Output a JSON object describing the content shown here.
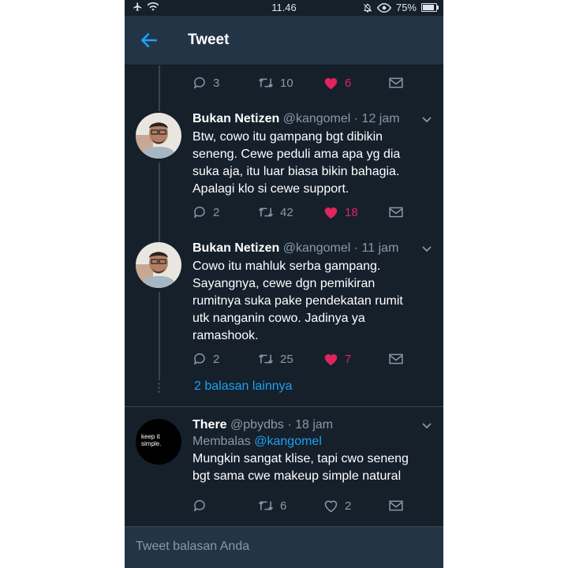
{
  "statusbar": {
    "time": "11.46",
    "battery": "75%"
  },
  "header": {
    "title": "Tweet"
  },
  "top_actions": {
    "reply": "3",
    "retweet": "10",
    "like": "6"
  },
  "tweets": [
    {
      "name": "Bukan Netizen",
      "handle": "@kangomel",
      "time": "· 12 jam",
      "text": "Btw, cowo itu gampang bgt dibikin seneng. Cewe peduli ama apa yg dia suka aja, itu luar biasa bikin bahagia. Apalagi klo si cewe support.",
      "reply": "2",
      "retweet": "42",
      "like": "18"
    },
    {
      "name": "Bukan Netizen",
      "handle": "@kangomel",
      "time": "· 11 jam",
      "text": "Cowo itu mahluk serba gampang. Sayangnya, cewe dgn pemikiran rumitnya suka pake pendekatan rumit utk nanganin cowo. Jadinya ya ramashook.",
      "reply": "2",
      "retweet": "25",
      "like": "7"
    },
    {
      "name": "There",
      "handle": "@pbydbs",
      "time": "· 18 jam",
      "replying_prefix": "Membalas",
      "replying_to": "@kangomel",
      "text": "Mungkin sangat klise, tapi cwo seneng bgt sama cwe makeup simple natural",
      "avatar_text": "keep it simple.",
      "reply": "",
      "retweet": "6",
      "like": "2"
    }
  ],
  "more_replies": "2 balasan lainnya",
  "composer": {
    "placeholder": "Tweet balasan Anda"
  },
  "colors": {
    "background": "#15202b",
    "header": "#243447",
    "accent": "#1da1f2",
    "like": "#e0245e",
    "muted": "#8899a6"
  }
}
